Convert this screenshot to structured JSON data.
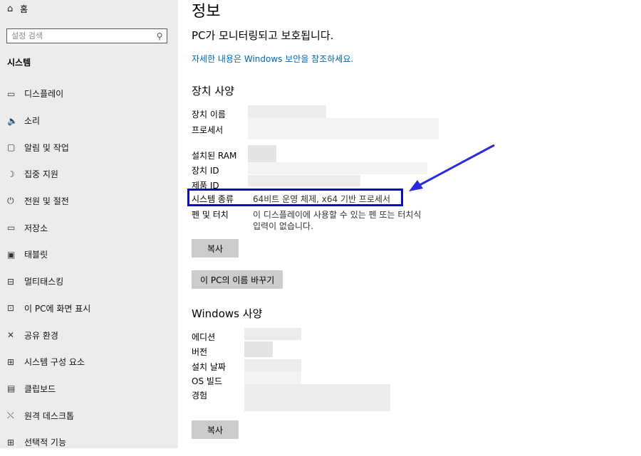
{
  "sidebar": {
    "home_label": "홈",
    "search_placeholder": "설정 검색",
    "section_title": "시스템",
    "items": [
      {
        "label": "디스플레이",
        "icon": "monitor-icon"
      },
      {
        "label": "소리",
        "icon": "speaker-icon"
      },
      {
        "label": "알림 및 작업",
        "icon": "notification-icon"
      },
      {
        "label": "집중 지원",
        "icon": "moon-icon"
      },
      {
        "label": "전원 및 절전",
        "icon": "power-icon"
      },
      {
        "label": "저장소",
        "icon": "storage-icon"
      },
      {
        "label": "태블릿",
        "icon": "tablet-icon"
      },
      {
        "label": "멀티태스킹",
        "icon": "multitasking-icon"
      },
      {
        "label": "이 PC에 화면 표시",
        "icon": "project-icon"
      },
      {
        "label": "공유 환경",
        "icon": "shared-experiences-icon"
      },
      {
        "label": "시스템 구성 요소",
        "icon": "components-icon"
      },
      {
        "label": "클립보드",
        "icon": "clipboard-icon"
      },
      {
        "label": "원격 데스크톱",
        "icon": "remote-desktop-icon"
      },
      {
        "label": "선택적 기능",
        "icon": "optional-features-icon"
      }
    ]
  },
  "main": {
    "title": "정보",
    "protection_text": "PC가 모니터링되고 보호됩니다.",
    "details_link": "자세한 내용은 Windows 보안을 참조하세요.",
    "device_specs": {
      "heading": "장치 사양",
      "labels": {
        "device_name": "장치 이름",
        "processor": "프로세서",
        "ram": "설치된 RAM",
        "device_id": "장치 ID",
        "product_id": "제품 ID",
        "system_type": "시스템 종류",
        "pen_touch": "펜 및 터치"
      },
      "system_type_value": "64비트 운영 체제, x64 기반 프로세서",
      "pen_touch_value_line1": "이 디스플레이에 사용할 수 있는 펜 또는 터치식",
      "pen_touch_value_line2": "입력이 없습니다.",
      "copy_button": "복사",
      "rename_button": "이 PC의 이름 바꾸기"
    },
    "windows_specs": {
      "heading": "Windows 사양",
      "labels": {
        "edition": "에디션",
        "version": "버전",
        "install_date": "설치 날짜",
        "os_build": "OS 빌드",
        "experience": "경험"
      },
      "copy_button": "복사"
    }
  },
  "annotation": {
    "color": "#0a0ac0"
  }
}
